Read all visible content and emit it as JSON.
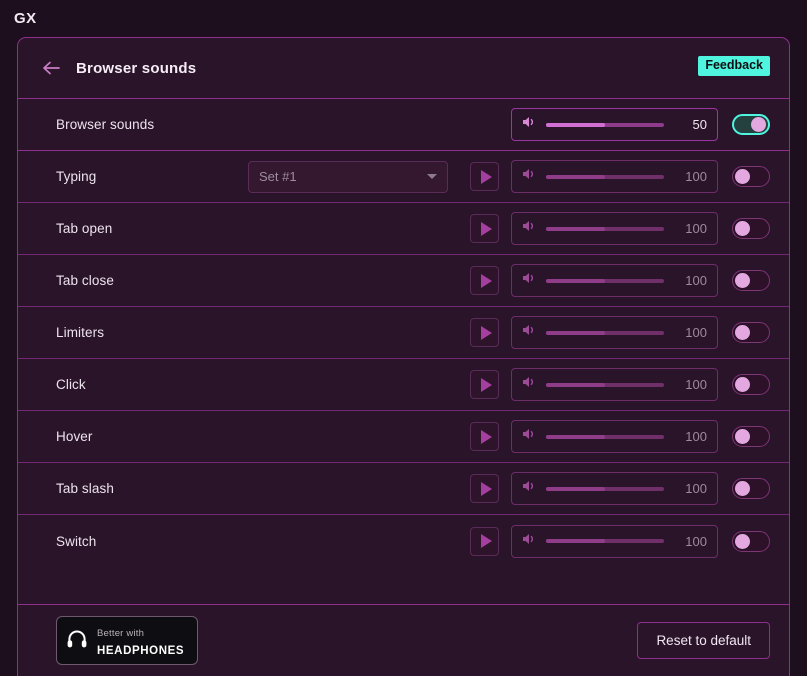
{
  "topbar": {
    "logo": "GX"
  },
  "header": {
    "back_icon": "arrow-left-icon",
    "title": "Browser sounds",
    "feedback_label": "Feedback",
    "feedback_color": "#4ff5de"
  },
  "master_row": {
    "label": "Browser sounds",
    "volume_icon": "speaker-icon",
    "volume_value": "50",
    "volume_percent": 50,
    "toggle_state": "on"
  },
  "sound_rows": [
    {
      "label": "Typing",
      "has_dropdown": true,
      "dropdown_value": "Set #1",
      "play_icon": "play-icon",
      "volume_icon": "speaker-icon",
      "volume_value": "100",
      "volume_percent": 50,
      "toggle_state": "off"
    },
    {
      "label": "Tab open",
      "has_dropdown": false,
      "dropdown_value": "",
      "play_icon": "play-icon",
      "volume_icon": "speaker-icon",
      "volume_value": "100",
      "volume_percent": 50,
      "toggle_state": "off"
    },
    {
      "label": "Tab close",
      "has_dropdown": false,
      "dropdown_value": "",
      "play_icon": "play-icon",
      "volume_icon": "speaker-icon",
      "volume_value": "100",
      "volume_percent": 50,
      "toggle_state": "off"
    },
    {
      "label": "Limiters",
      "has_dropdown": false,
      "dropdown_value": "",
      "play_icon": "play-icon",
      "volume_icon": "speaker-icon",
      "volume_value": "100",
      "volume_percent": 50,
      "toggle_state": "off"
    },
    {
      "label": "Click",
      "has_dropdown": false,
      "dropdown_value": "",
      "play_icon": "play-icon",
      "volume_icon": "speaker-icon",
      "volume_value": "100",
      "volume_percent": 50,
      "toggle_state": "off"
    },
    {
      "label": "Hover",
      "has_dropdown": false,
      "dropdown_value": "",
      "play_icon": "play-icon",
      "volume_icon": "speaker-icon",
      "volume_value": "100",
      "volume_percent": 50,
      "toggle_state": "off"
    },
    {
      "label": "Tab slash",
      "has_dropdown": false,
      "dropdown_value": "",
      "play_icon": "play-icon",
      "volume_icon": "speaker-icon",
      "volume_value": "100",
      "volume_percent": 50,
      "toggle_state": "off"
    },
    {
      "label": "Switch",
      "has_dropdown": false,
      "dropdown_value": "",
      "play_icon": "play-icon",
      "volume_icon": "speaker-icon",
      "volume_value": "100",
      "volume_percent": 50,
      "toggle_state": "off"
    }
  ],
  "footer": {
    "headphones_icon": "headphones-icon",
    "headphones_line1": "Better with",
    "headphones_line2": "HEADPHONES",
    "reset_label": "Reset to default"
  }
}
